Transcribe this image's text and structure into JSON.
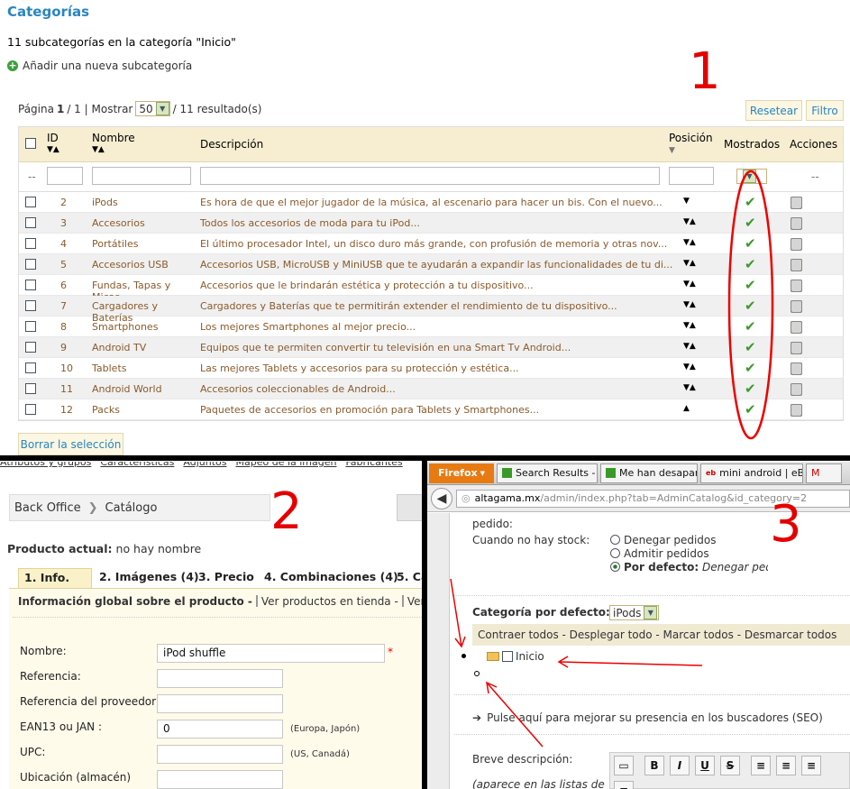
{
  "header": {
    "title": "Categorías",
    "subtitle": "11 subcategorías en la categoría \"Inicio\"",
    "add_link": "Añadir una nueva subcategoría"
  },
  "annotations": {
    "n1": "1",
    "n2": "2",
    "n3": "3"
  },
  "pager": {
    "page_label": "Página",
    "page_current": "1",
    "page_sep": "/ 1 | Mostrar",
    "show_value": "50",
    "results": "/ 11 resultado(s)"
  },
  "buttons": {
    "reset": "Resetear",
    "filter": "Filtro",
    "delete_selection": "Borrar la selección"
  },
  "columns": {
    "id": "ID",
    "name": "Nombre",
    "description": "Descripción",
    "position": "Posición",
    "shown": "Mostrados",
    "actions": "Acciones",
    "filter_dash": "--"
  },
  "rows": [
    {
      "id": "2",
      "name": "iPods",
      "desc": "Es hora de que el mejor jugador de la música, al escenario para hacer un bis. Con el nuevo...",
      "pos": "down"
    },
    {
      "id": "3",
      "name": "Accesorios",
      "desc": "Todos los accesorios de moda para tu iPod...",
      "pos": "both"
    },
    {
      "id": "4",
      "name": "Portátiles",
      "desc": "El último procesador Intel, un disco duro más grande, con profusión de memoria y otras nov...",
      "pos": "both"
    },
    {
      "id": "5",
      "name": "Accesorios USB",
      "desc": "Accesorios USB, MicroUSB y MiniUSB que te ayudarán a expandir las funcionalidades de tu di...",
      "pos": "both"
    },
    {
      "id": "6",
      "name": "Fundas, Tapas y Micas",
      "desc": "Accesorios que le brindarán estética y protección a tu dispositivo...",
      "pos": "both"
    },
    {
      "id": "7",
      "name": "Cargadores y Baterías",
      "desc": "Cargadores y Baterías que te permitirán extender el rendimiento de tu dispositivo...",
      "pos": "both"
    },
    {
      "id": "8",
      "name": "Smartphones",
      "desc": "Los mejores Smartphones al mejor precio...",
      "pos": "both"
    },
    {
      "id": "9",
      "name": "Android TV",
      "desc": "Equipos que te permiten convertir tu televisión en una Smart Tv Android...",
      "pos": "both"
    },
    {
      "id": "10",
      "name": "Tablets",
      "desc": "Las mejores Tablets y accesorios para su protección y estética...",
      "pos": "both"
    },
    {
      "id": "11",
      "name": "Android World",
      "desc": "Accesorios coleccionables de Android...",
      "pos": "both"
    },
    {
      "id": "12",
      "name": "Packs",
      "desc": "Paquetes de accesorios en promoción para Tablets y Smartphones...",
      "pos": "up"
    }
  ],
  "panel2": {
    "top_links": [
      "Atributos y grupos",
      "Características",
      "Adjuntos",
      "Mapeo de la imagen",
      "Fabricantes"
    ],
    "breadcrumb": [
      "Back Office",
      "Catálogo"
    ],
    "current_label": "Producto actual:",
    "current_value": "no hay nombre",
    "tabs": [
      "1. Info.",
      "2. Imágenes (4)",
      "3. Precio",
      "4. Combinaciones (4)",
      "5. Ca"
    ],
    "info_title": "Información global sobre el producto -",
    "view_shop": "Ver productos en tienda -",
    "view_more": "Ver las ve",
    "fields": [
      {
        "label": "Nombre:",
        "value": "iPod shuffle",
        "note": "*"
      },
      {
        "label": "Referencia:",
        "value": "",
        "note": ""
      },
      {
        "label": "Referencia del proveedor:",
        "value": "",
        "note": ""
      },
      {
        "label": "EAN13 ou JAN :",
        "value": "0",
        "note": "(Europa, Japón)"
      },
      {
        "label": "UPC:",
        "value": "",
        "note": "(US, Canadá)"
      },
      {
        "label": "Ubicación (almacén)",
        "value": "",
        "note": ""
      }
    ]
  },
  "panel3": {
    "browser_button": "Firefox",
    "tabs": [
      "Search Results - ...",
      "Me han desapar...",
      "mini android | eB...",
      "M"
    ],
    "url_domain": "altagama.mx",
    "url_path": "/admin/index.php?tab=AdminCatalog&id_category=2",
    "ordered_label": "pedido:",
    "nostock_label": "Cuando no hay stock:",
    "options": [
      "Denegar pedidos",
      "Admitir pedidos"
    ],
    "default_option_label": "Por defecto:",
    "default_option_value": "Denegar pedido",
    "default_cat_label": "Categoría por defecto:",
    "default_cat_value": "iPods",
    "tree_actions": "Contraer todos - Desplegar todo - Marcar todos - Desmarcar todos",
    "tree_root": "Inicio",
    "seo_link": "Pulse aquí para mejorar su presencia en los buscadores (SEO)",
    "short_desc_label": "Breve descripción:",
    "short_desc_hint": "(aparece en las listas de",
    "toolbar": [
      "B",
      "I",
      "U",
      "S"
    ]
  }
}
